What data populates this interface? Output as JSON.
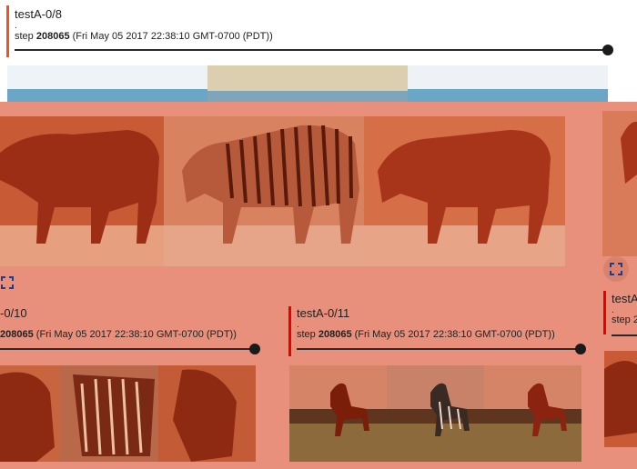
{
  "cards": [
    {
      "title": "testA-0/8",
      "dot": ".",
      "step_label": "step",
      "step_value": "208065",
      "step_date": "(Fri May 05 2017 22:38:10 GMT-0700 (PDT))"
    },
    {
      "title": "-0/10",
      "step_value": "208065",
      "step_date": "(Fri May 05 2017 22:38:10 GMT-0700 (PDT))"
    },
    {
      "title": "testA-0/11",
      "dot": ".",
      "step_label": "step",
      "step_value": "208065",
      "step_date": "(Fri May 05 2017 22:38:10 GMT-0700 (PDT))"
    },
    {
      "title": "testA",
      "dot": ".",
      "step_label": "step 2"
    }
  ],
  "icons": {
    "expand": "fullscreen-icon"
  },
  "colors": {
    "accent": "#f4511e",
    "overlay": "#e8907c",
    "track": "#2b2b2b"
  }
}
